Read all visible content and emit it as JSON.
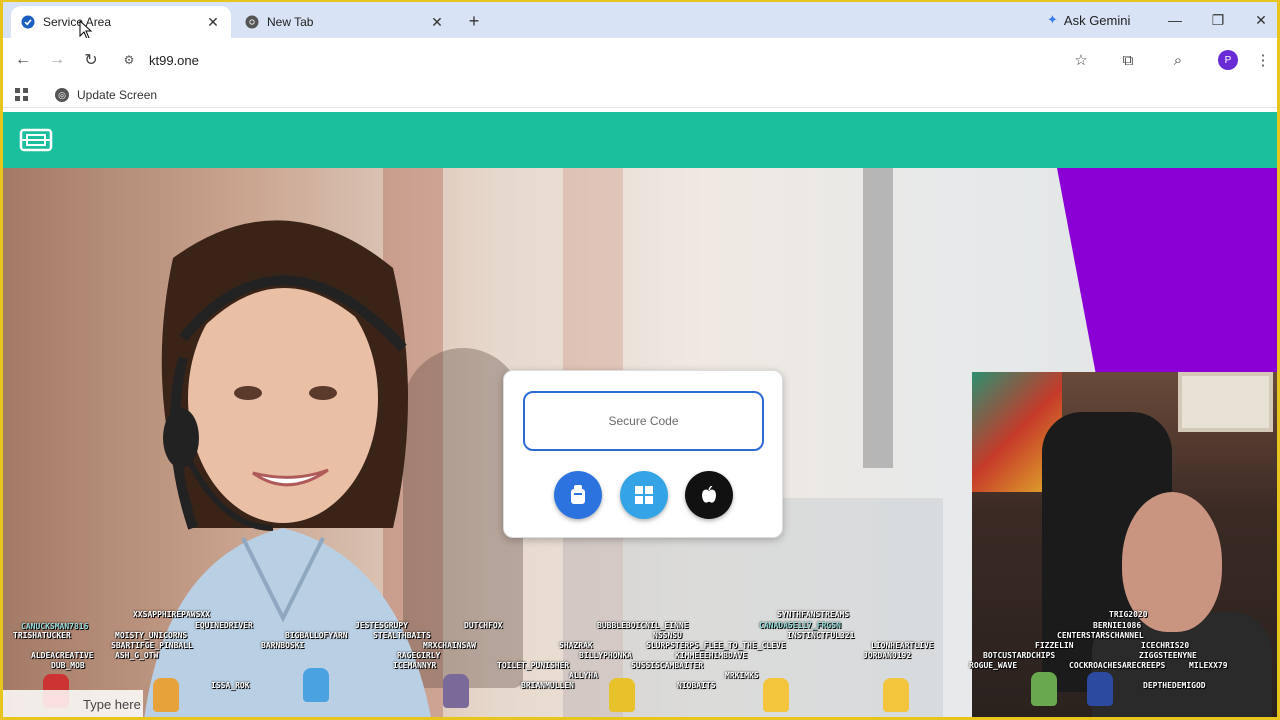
{
  "browser": {
    "tabs": [
      {
        "title": "Service Area",
        "active": true
      },
      {
        "title": "New Tab",
        "active": false
      }
    ],
    "ask_gemini": "Ask Gemini",
    "url": "kt99.one",
    "profile_initial": "P",
    "bookmarks": [
      {
        "label": "Update Screen"
      }
    ]
  },
  "page": {
    "brand_color": "#1bbf9d",
    "accent_purple": "#8a00d4",
    "secure_code_placeholder": "Secure Code",
    "download_buttons": [
      {
        "name": "android-download",
        "icon": "android-icon",
        "color": "#2c73e0"
      },
      {
        "name": "windows-download",
        "icon": "windows-icon",
        "color": "#35a4e6"
      },
      {
        "name": "apple-download",
        "icon": "apple-icon",
        "color": "#111111"
      }
    ]
  },
  "stream_overlay": {
    "chat_names": [
      "CANUCKSMAN7816",
      "XXSAPPHIREPAWSXX",
      "EQUINEDRIVER",
      "JESTESGRUPY",
      "DUTCHFOX",
      "BUBBLEBOICNIL_EINNE",
      "SYNTHFANSTREAMS",
      "TRISHATUCKER",
      "MOISTY_UNICORNS",
      "BIGBALLOFYARN",
      "STEALTHBAITS",
      "NSSNSU",
      "CANADA5E117_FRGSN",
      "INSTINCTFUL321",
      "SBARTIFGE_PINBALL",
      "BARNBOSKI",
      "MRXCHAINSAW",
      "SHAZRAK",
      "SLURPSTERPS_FLEE_TO_THE_CLEVE",
      "LIONHEARTLIVE",
      "ALDEACREATIVE",
      "ASH_G_OTW",
      "RAGEGIRLY",
      "BILLYPHONKA",
      "KIMMEEEHIMBDAVE",
      "JORDAN0192",
      "DUB_MOB",
      "ICEMANNYR",
      "TOILET_PUNISHER",
      "SUSSISCAMBAITER",
      "MRKIMKS",
      "ISSA_ROK",
      "ALLYHA",
      "BRIANMULLEN",
      "NIOBAITS",
      "TRIG2020",
      "BERNIE1086",
      "CENTERSTARSCHANNEL",
      "FIZZELIN",
      "ICECHRIS20",
      "BOTCUSTARDCHIPS",
      "ZIGGSTEENYNE",
      "ROGUE_WAVE",
      "COCKROACHESARECREEPS",
      "MILEXX79",
      "DEPTHEDEMIGOD"
    ],
    "taskbar_search_placeholder": "Type here"
  }
}
